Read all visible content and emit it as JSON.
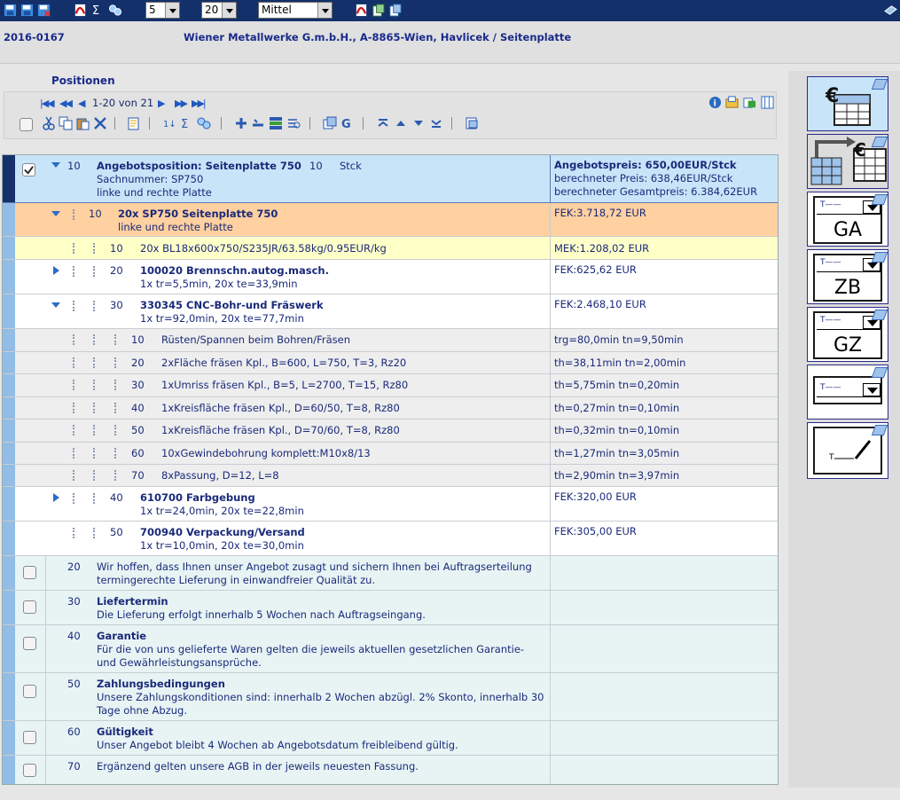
{
  "toolbar": {
    "page_size_1": "5",
    "page_size_2": "20",
    "view_mode": "Mittel"
  },
  "header": {
    "code": "2016-0167",
    "title": "Wiener Metallwerke G.m.b.H., A-8865-Wien, Havlicek / Seitenplatte"
  },
  "positions": {
    "label": "Positionen",
    "pager": "1-20 von 21"
  },
  "rows": {
    "r0": {
      "num": "10",
      "title": "Angebotsposition: Seitenplatte 750",
      "qty": "10",
      "unit": "Stck",
      "line2": "Sachnummer: SP750",
      "line3": "linke und rechte Platte",
      "right1": "Angebotspreis: 650,00EUR/Stck",
      "right2": "berechneter Preis: 638,46EUR/Stck",
      "right3": "berechneter Gesamtpreis: 6.384,62EUR"
    },
    "r1": {
      "num": "10",
      "title": "20x SP750 Seitenplatte 750",
      "line2": "linke und rechte Platte",
      "right": "FEK:3.718,72 EUR"
    },
    "r2": {
      "num": "10",
      "title": "20x BL18x600x750/S235JR/63.58kg/0.95EUR/kg",
      "right": "MEK:1.208,02 EUR"
    },
    "r3": {
      "num": "20",
      "title": "100020 Brennschn.autog.masch.",
      "line2": "1x tr=5,5min, 20x te=33,9min",
      "right": "FEK:625,62 EUR"
    },
    "r4": {
      "num": "30",
      "title": "330345 CNC-Bohr-und Fräswerk",
      "line2": "1x tr=92,0min, 20x te=77,7min",
      "right": "FEK:2.468,10 EUR"
    },
    "ops": [
      {
        "num": "10",
        "text": "Rüsten/Spannen beim Bohren/Fräsen",
        "right": "trg=80,0min tn=9,50min"
      },
      {
        "num": "20",
        "text": "2xFläche fräsen Kpl., B=600, L=750, T=3, Rz20",
        "right": "th=38,11min tn=2,00min"
      },
      {
        "num": "30",
        "text": "1xUmriss fräsen Kpl., B=5, L=2700, T=15, Rz80",
        "right": "th=5,75min tn=0,20min"
      },
      {
        "num": "40",
        "text": "1xKreisfläche fräsen Kpl., D=60/50, T=8, Rz80",
        "right": "th=0,27min tn=0,10min"
      },
      {
        "num": "50",
        "text": "1xKreisfläche fräsen Kpl., D=70/60, T=8, Rz80",
        "right": "th=0,32min tn=0,10min"
      },
      {
        "num": "60",
        "text": "10xGewindebohrung komplett:M10x8/13",
        "right": "th=1,27min tn=3,05min"
      },
      {
        "num": "70",
        "text": "8xPassung, D=12, L=8",
        "right": "th=2,90min tn=3,97min"
      }
    ],
    "r5": {
      "num": "40",
      "title": "610700 Farbgebung",
      "line2": "1x tr=24,0min, 20x te=22,8min",
      "right": "FEK:320,00 EUR"
    },
    "r6": {
      "num": "50",
      "title": "700940 Verpackung/Versand",
      "line2": "1x tr=10,0min, 20x te=30,0min",
      "right": "FEK:305,00 EUR"
    },
    "t20": {
      "num": "20",
      "line1": "Wir hoffen, dass Ihnen unser Angebot zusagt und sichern Ihnen bei Auftragserteilung",
      "line2": "termingerechte Lieferung in einwandfreier Qualität zu."
    },
    "t30": {
      "num": "30",
      "title": "Liefertermin",
      "line2": "Die Lieferung erfolgt innerhalb 5 Wochen nach Auftragseingang."
    },
    "t40": {
      "num": "40",
      "title": "Garantie",
      "line2": "Für die von uns gelieferte Waren gelten die jeweils aktuellen gesetzlichen Garantie-",
      "line3": "und Gewährleistungsansprüche."
    },
    "t50": {
      "num": "50",
      "title": "Zahlungsbedingungen",
      "line2": "Unsere Zahlungskonditionen sind: innerhalb 2 Wochen abzügl. 2% Skonto, innerhalb 30",
      "line3": "Tage ohne Abzug."
    },
    "t60": {
      "num": "60",
      "title": "Gültigkeit",
      "line2": "Unser Angebot bleibt 4 Wochen ab Angebotsdatum freibleibend gültig."
    },
    "t70": {
      "num": "70",
      "line1": "Ergänzend gelten unsere AGB in der jeweils neuesten Fassung."
    }
  },
  "side": {
    "ga": "GA",
    "zb": "ZB",
    "gz": "GZ"
  },
  "colors": {
    "topbar": "#13306b",
    "selected_row": "#c8e4f8",
    "component_row": "#ffd0a0",
    "material_row": "#ffffc8",
    "operation_row": "#eeeeee",
    "text_row": "#e8f4f4"
  }
}
